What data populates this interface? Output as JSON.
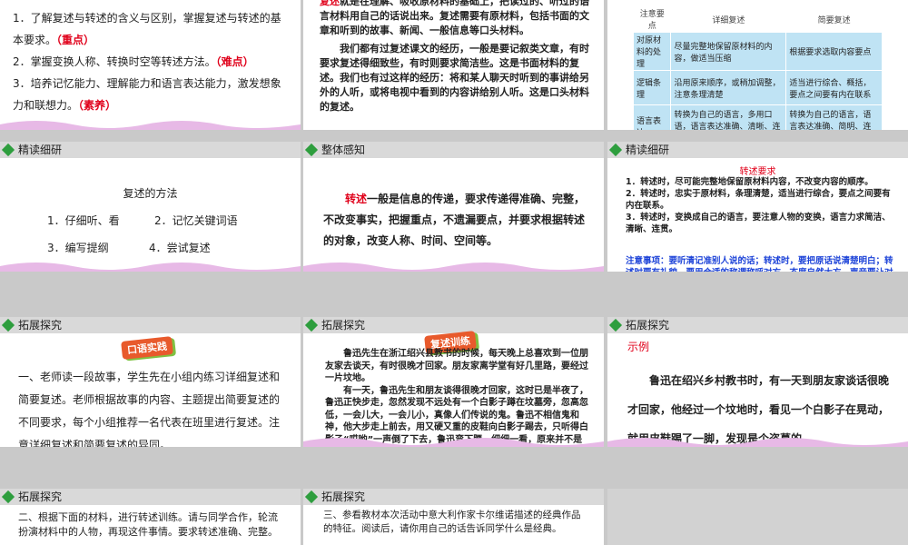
{
  "slides": {
    "s1": {
      "lines": [
        {
          "text": "1．了解复述与转述的含义与区别，掌握复述与转述的基本要求。",
          "tag": "（重点）"
        },
        {
          "text": "2．掌握变换人称、转换时空等转述方法。",
          "tag": "（难点）"
        },
        {
          "text": "3．培养记忆能力、理解能力和语言表达能力，激发想象力和联想力。",
          "tag": "（素养）"
        }
      ]
    },
    "s2": {
      "p1_lead": "复述",
      "p1": "就是在理解、吸收原材料的基础上，把读过的、听过的语言材料用自己的话说出来。复述需要有原材料，包括书面的文章和听到的故事、新闻、一般信息等口头材料。",
      "p2": "我们都有过复述课文的经历，一般是要记叙类文章，有时要求复述得细致些，有时则要求简洁些。这是书面材料的复述。我们也有过这样的经历：将和某人聊天时听到的事讲给另外的人听，或将电视中看到的内容讲给别人听。这是口头材料的复述。"
    },
    "s3": {
      "headers": [
        "注意要点",
        "详细复述",
        "简要复述"
      ],
      "rows": [
        [
          "对原材料的处理",
          "尽量完整地保留原材料的内容，做适当压缩",
          "根据要求选取内容要点"
        ],
        [
          "逻辑条理",
          "沿用原来顺序，或稍加调整，注意条理清楚",
          "适当进行综合、概括，要点之间要有内在联系"
        ],
        [
          "语言表达",
          "转换为自己的语言，多用口语，语言表达准确、清晰、连贯",
          "转换为自己的语言，语言表达准确、简明、连贯"
        ]
      ]
    },
    "s4": {
      "header": "精读细研",
      "title": "复述的方法",
      "items": [
        "1．仔细听、看",
        "2．记忆关键词语",
        "3．编写提纲",
        "4．尝试复述"
      ]
    },
    "s5": {
      "header": "整体感知",
      "lead": "转述",
      "body": "一般是信息的传递，要求传递得准确、完整，不改变事实，把握重点，不遗漏要点，并要求根据转述的对象，改变人称、时间、空间等。"
    },
    "s6": {
      "header": "精读细研",
      "title": "转述要求",
      "items": [
        "1．转述时，尽可能完整地保留原材料内容，不改变内容的顺序。",
        "2．转述时，忠实于原材料，条理清楚，适当进行综合，要点之间要有内在联系。",
        "3．转述时，变换成自己的语言，要注意人物的变换，语言力求简洁、清晰、连贯。"
      ],
      "note": "注意事项：要听清记准别人说的话；转述时，要把原话说清楚明白；转述时要有礼貌，要用合适的称谓称呼对方，态度自然大方，声音要让对方听见。"
    },
    "s7": {
      "header": "拓展探究",
      "badge": "口语实践",
      "body": "一、老师读一段故事，学生先在小组内练习详细复述和简要复述。老师根据故事的内容、主题提出简要复述的不同要求，每个小组推荐一名代表在班里进行复述。注意详细复述和简要复述的异同。"
    },
    "s8": {
      "header": "拓展探究",
      "badge": "复述训练",
      "p1": "鲁迅先生在浙江绍兴县教书的时候，每天晚上总喜欢到一位朋友家去谈天，有时很晚才回家。朋友家离学堂有好几里路，要经过一片坟地。",
      "p2": "有一天，鲁迅先生和朋友谈得很晚才回家，这时已是半夜了，鲁迅正快步走，忽然发现不远处有一个白影子蹲在坟墓旁，忽高忽低，一会儿大，一会儿小，真像人们传说的鬼。鲁迅不相信鬼和神，他大步走上前去，用又硬又重的皮鞋向白影子踢去，只听得白影子“哎哟”一声倒了下去，鲁迅弯下腰，细细一看，原来并不是什么鬼，而是一个盗墓的。"
    },
    "s9": {
      "header": "拓展探究",
      "label": "示例",
      "body": "鲁迅在绍兴乡村教书时，有一天到朋友家谈话很晚才回家，他经过一个坟地时，看见一个白影子在晃动，就用皮鞋踢了一脚，发现是个盗墓的。"
    },
    "s10": {
      "header": "拓展探究",
      "body": "二、根据下面的材料，进行转述训练。请与同学合作，轮流扮演材料中的人物，再现这件事情。要求转述准确、完整。"
    },
    "s11": {
      "header": "拓展探究",
      "body": "三、参看教材本次活动中意大利作家卡尔维诺描述的经典作品的特征。阅读后，请你用自己的话告诉同学什么是经典。"
    }
  }
}
